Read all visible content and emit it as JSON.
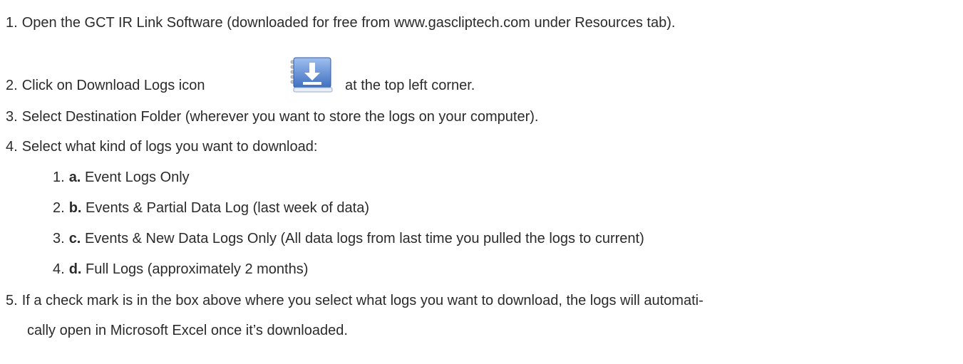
{
  "steps": [
    {
      "num": "1.",
      "text": "Open the GCT IR Link Software (downloaded for free from www.gascliptech.com under Resources tab)."
    },
    {
      "num": "2.",
      "text_before": "Click on Download Logs icon",
      "text_after": "at the top left corner.",
      "icon": "download-logs-icon"
    },
    {
      "num": "3.",
      "text": "Select Destination Folder (wherever you want to store the logs on your computer)."
    },
    {
      "num": "4.",
      "text": "Select what kind of logs you want to download:"
    },
    {
      "num": "5.",
      "text_line1": "If a check mark is in the box above where you select what logs you want to download, the logs will automati-",
      "text_line2": "cally open in Microsoft Excel once it’s downloaded."
    }
  ],
  "substeps": [
    {
      "num": "1.",
      "letter": "a.",
      "text": "Event Logs Only"
    },
    {
      "num": "2.",
      "letter": "b.",
      "text": "Events & Partial Data Log (last week of data)"
    },
    {
      "num": "3.",
      "letter": "c.",
      "text": "Events & New Data Logs Only (All data logs from last time you pulled the logs to current)"
    },
    {
      "num": "4.",
      "letter": "d.",
      "text": "Full Logs (approximately 2 months)"
    }
  ],
  "colors": {
    "text": "#2b2b2b",
    "icon_blue": "#4a78c6",
    "icon_blue_light": "#7fa6e6"
  }
}
